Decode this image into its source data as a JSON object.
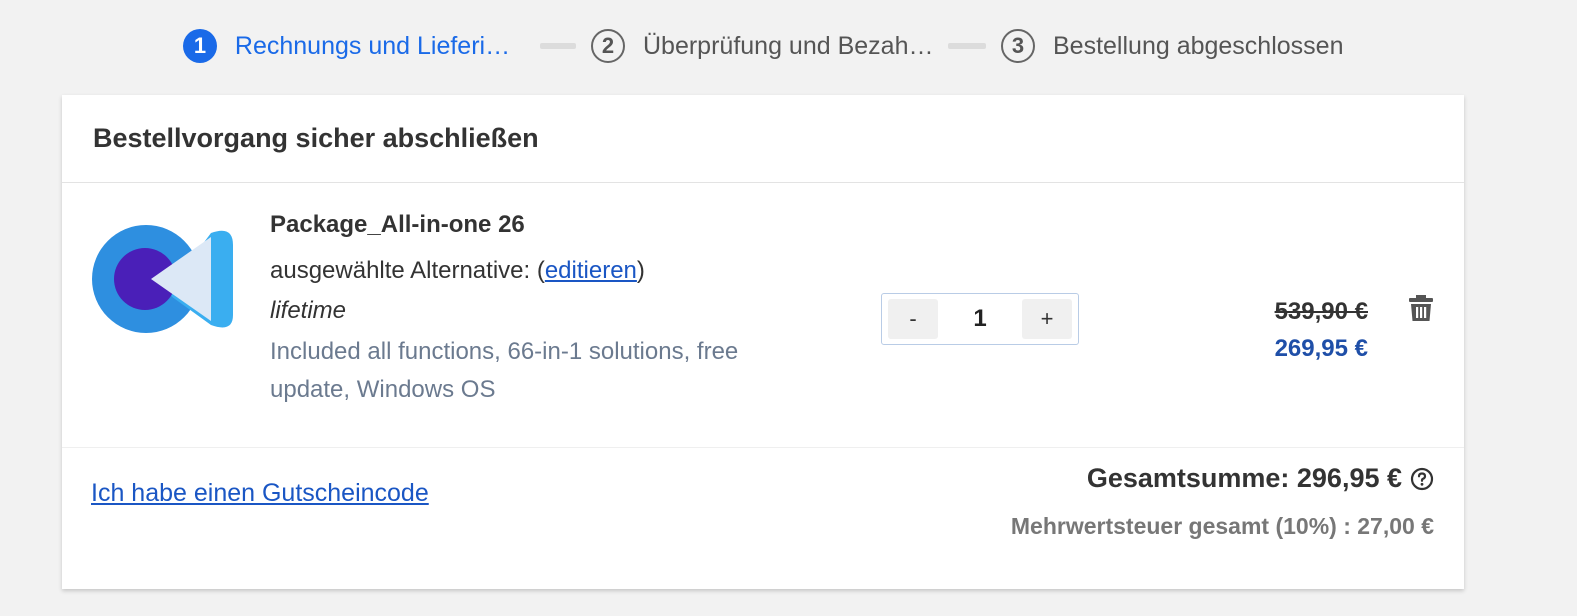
{
  "stepper": {
    "steps": [
      {
        "number": "1",
        "label": "Rechnungs und Lieferin…",
        "state": "active"
      },
      {
        "number": "2",
        "label": "Überprüfung und Bezah…",
        "state": "inactive"
      },
      {
        "number": "3",
        "label": "Bestellung abgeschlossen",
        "state": "inactive"
      }
    ]
  },
  "card": {
    "title": "Bestellvorgang sicher abschließen"
  },
  "product": {
    "icon": "video-camera-app-logo",
    "name": "Package_All-in-one 26",
    "alt_prefix": "ausgewählte Alternative: (",
    "edit_link": "editieren",
    "alt_suffix": ")",
    "license": "lifetime",
    "description": "Included all functions, 66-in-1 solutions, free update, Windows OS",
    "quantity": {
      "minus": "-",
      "value": "1",
      "plus": "+"
    },
    "price_old": "539,90 €",
    "price_new": "269,95 €",
    "delete_icon": "trash-icon"
  },
  "footer": {
    "coupon_link": "Ich habe einen Gutscheincode",
    "total": "Gesamtsumme: 296,95 €",
    "help_icon": "question-circle-icon",
    "vat": "Mehrwertsteuer gesamt (10%) : 27,00 €"
  },
  "colors": {
    "accent": "#1a6ae8",
    "link": "#1a56c4",
    "price": "#1f4fa8",
    "muted_text": "#6b7a8f",
    "background": "#f2f2f2"
  }
}
